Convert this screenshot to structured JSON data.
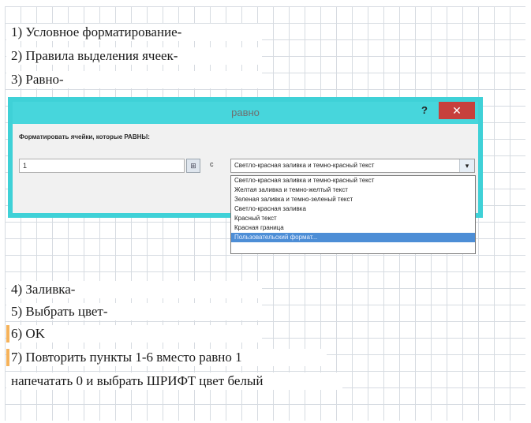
{
  "steps": {
    "s1": "1) Условное форматирование-",
    "s2": "2) Правила выделения ячеек-",
    "s3": "3) Равно-",
    "s4": "4) Заливка-",
    "s5": "5) Выбрать цвет-",
    "s6": "6) OK",
    "s7": "7)  Повторить пункты 1-6 вместо равно 1",
    "s8": "напечатать 0 и выбрать ШРИФТ цвет белый"
  },
  "dialog": {
    "title": "равно",
    "help": "?",
    "close": "✕",
    "prompt": "Форматировать ячейки, которые РАВНЫ:",
    "value": "1",
    "ref_icon": "⊞",
    "with": "с",
    "format_value": "Светло-красная заливка и темно-красный текст",
    "arrow": "▾",
    "options": [
      "Светло-красная заливка и темно-красный текст",
      "Желтая заливка и темно-желтый текст",
      "Зеленая заливка и темно-зеленый текст",
      "Светло-красная заливка",
      "Красный текст",
      "Красная граница",
      "Пользовательский формат..."
    ]
  }
}
